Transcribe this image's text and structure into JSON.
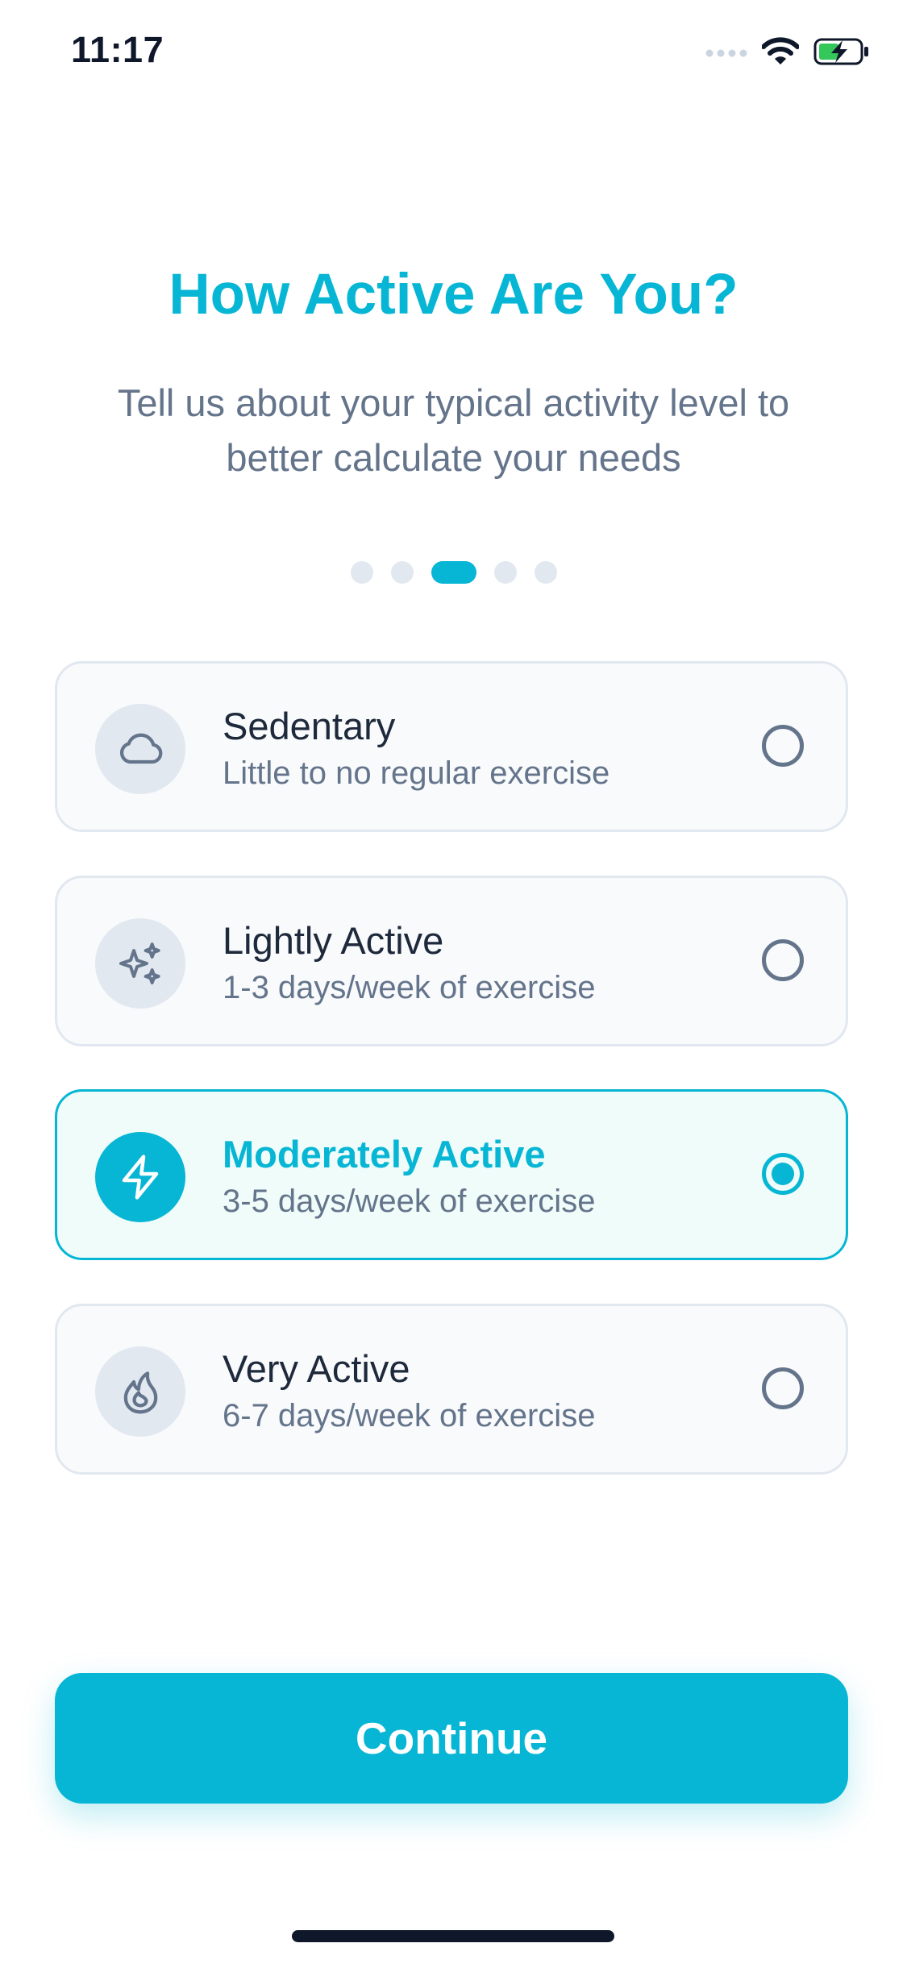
{
  "status_bar": {
    "time": "11:17",
    "icons": [
      "signal-icon",
      "wifi-icon",
      "battery-charging-icon"
    ]
  },
  "header": {
    "title": "How Active Are You?",
    "subtitle": "Tell us about your typical activity level to better calculate your needs"
  },
  "pager": {
    "total": 5,
    "current": 3
  },
  "options": [
    {
      "title": "Sedentary",
      "description": "Little to no regular exercise",
      "icon": "cloud-icon",
      "selected": false
    },
    {
      "title": "Lightly Active",
      "description": "1-3 days/week of exercise",
      "icon": "sparkles-icon",
      "selected": false
    },
    {
      "title": "Moderately Active",
      "description": "3-5 days/week of exercise",
      "icon": "lightning-icon",
      "selected": true
    },
    {
      "title": "Very Active",
      "description": "6-7 days/week of exercise",
      "icon": "flame-icon",
      "selected": false
    }
  ],
  "continue_button": {
    "label": "Continue"
  },
  "colors": {
    "accent": "#06b6d4",
    "muted_text": "#64748b",
    "card_bg": "#f8fafc",
    "card_selected_bg": "#effcf9",
    "border": "#e2e8f0"
  }
}
